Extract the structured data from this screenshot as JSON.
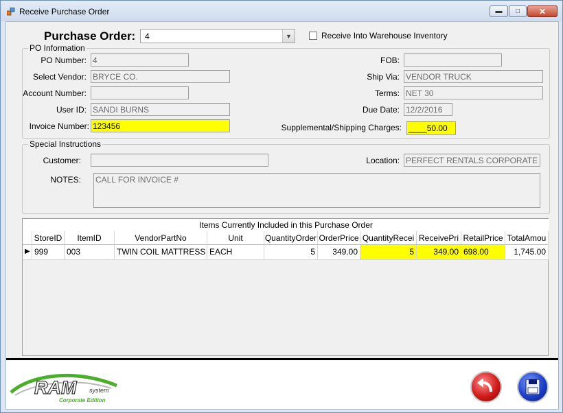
{
  "window": {
    "title": "Receive Purchase Order"
  },
  "header": {
    "po_label": "Purchase Order:",
    "po_value": "4",
    "warehouse_checkbox_label": "Receive Into Warehouse Inventory"
  },
  "po_info": {
    "group_title": "PO Information",
    "po_number_label": "PO Number:",
    "po_number": "4",
    "vendor_label": "Select Vendor:",
    "vendor": "BRYCE CO.",
    "account_label": "Account Number:",
    "account": "",
    "user_label": "User ID:",
    "user": "SANDI BURNS",
    "invoice_label": "Invoice Number:",
    "invoice": "123456",
    "fob_label": "FOB:",
    "fob": "",
    "ship_via_label": "Ship Via:",
    "ship_via": "VENDOR TRUCK",
    "terms_label": "Terms:",
    "terms": "NET 30",
    "due_date_label": "Due Date:",
    "due_date": "12/2/2016",
    "charges_label": "Supplemental/Shipping Charges:",
    "charges": "____50.00"
  },
  "special": {
    "group_title": "Special Instructions",
    "customer_label": "Customer:",
    "customer": "",
    "location_label": "Location:",
    "location": "PERFECT RENTALS CORPORATE",
    "notes_label": "NOTES:",
    "notes": "CALL FOR INVOICE #"
  },
  "grid": {
    "caption": "Items Currently Included in this Purchase Order",
    "columns": [
      "StoreID",
      "ItemID",
      "VendorPartNo",
      "Unit",
      "QuantityOrder",
      "OrderPrice",
      "QuantityRecei",
      "ReceivePri",
      "RetailPrice",
      "TotalAmou"
    ],
    "rows": [
      [
        "999",
        "003",
        "TWIN COIL MATTRESS",
        "EACH",
        "5",
        "349.00",
        "5",
        "349.00",
        "698.00",
        "1,745.00"
      ]
    ]
  },
  "footer": {
    "logo_text": "RAM",
    "logo_sub": "system",
    "logo_edition": "Corporate Edition"
  },
  "colors": {
    "highlight": "#ffff00",
    "back_button": "#d11b1b",
    "save_button": "#1b3fc9",
    "logo_green": "#4caf2c"
  }
}
